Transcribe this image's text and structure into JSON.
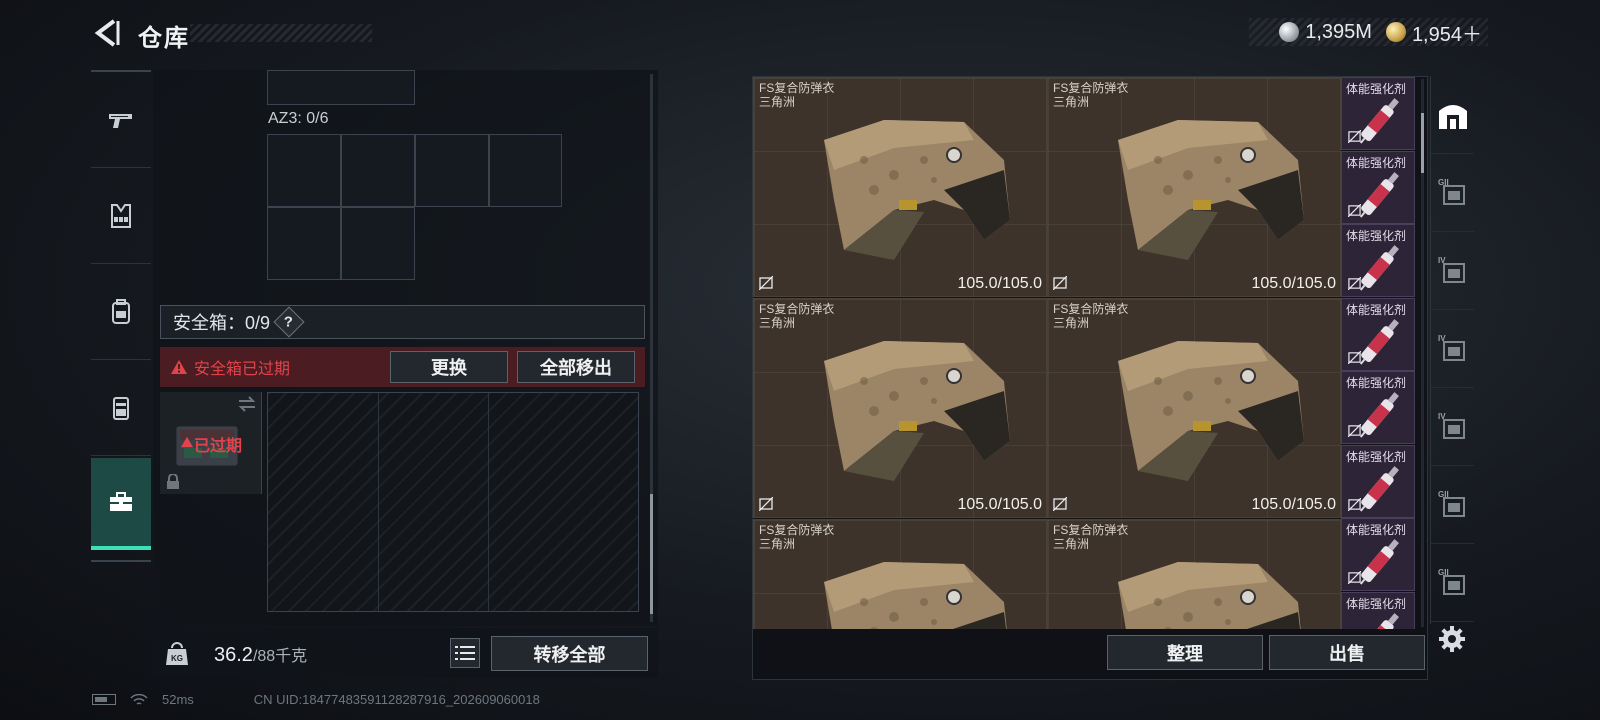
{
  "header": {
    "title": "仓库",
    "currencies": [
      {
        "icon": "silver-coin-icon",
        "value": "1,395M"
      },
      {
        "icon": "gold-coin-icon",
        "value": "1,954＋"
      }
    ]
  },
  "left_nav": {
    "items": [
      {
        "name": "weapons",
        "icon": "pistol-icon"
      },
      {
        "name": "chest-rig",
        "icon": "chest-rig-icon"
      },
      {
        "name": "backpack",
        "icon": "backpack-icon"
      },
      {
        "name": "pouch",
        "icon": "pouch-icon"
      },
      {
        "name": "safe-box",
        "icon": "toolbox-icon",
        "active": true
      }
    ]
  },
  "loadout": {
    "az3_label": "AZ3: 0/6",
    "safebox_label": "安全箱：0/9",
    "help": "?",
    "expired_message": "安全箱已过期",
    "replace_label": "更换",
    "remove_all_label": "全部移出",
    "item_expired_label": "已过期"
  },
  "weight": {
    "current": "36.2",
    "max_unit": "/88千克",
    "icon_text": "KG",
    "transfer_all_label": "转移全部"
  },
  "stash": {
    "vests": [
      {
        "name": "FS复合防弹衣",
        "tag": "三角洲",
        "durability": "105.0/105.0"
      },
      {
        "name": "FS复合防弹衣",
        "tag": "三角洲",
        "durability": "105.0/105.0"
      },
      {
        "name": "FS复合防弹衣",
        "tag": "三角洲",
        "durability": "105.0/105.0"
      },
      {
        "name": "FS复合防弹衣",
        "tag": "三角洲",
        "durability": "105.0/105.0"
      },
      {
        "name": "FS复合防弹衣",
        "tag": "三角洲",
        "durability": ""
      },
      {
        "name": "FS复合防弹衣",
        "tag": "三角洲",
        "durability": ""
      }
    ],
    "stims": [
      {
        "name": "体能强化剂"
      },
      {
        "name": "体能强化剂"
      },
      {
        "name": "体能强化剂"
      },
      {
        "name": "体能强化剂"
      },
      {
        "name": "体能强化剂"
      },
      {
        "name": "体能强化剂"
      },
      {
        "name": "体能强化剂"
      },
      {
        "name": "体能强化剂"
      }
    ],
    "sort_label": "整理",
    "sell_label": "出售"
  },
  "right_nav": {
    "items": [
      {
        "name": "home",
        "label": ""
      },
      {
        "name": "tab-gii-1",
        "label": "GII"
      },
      {
        "name": "tab-iv-1",
        "label": "IV"
      },
      {
        "name": "tab-iv-2",
        "label": "IV"
      },
      {
        "name": "tab-iv-3",
        "label": "IV"
      },
      {
        "name": "tab-gii-2",
        "label": "GII"
      },
      {
        "name": "tab-gii-3",
        "label": "GII"
      }
    ]
  },
  "status": {
    "ping": "52ms",
    "uid": "CN UID:18477483591128287916_202609060018"
  }
}
